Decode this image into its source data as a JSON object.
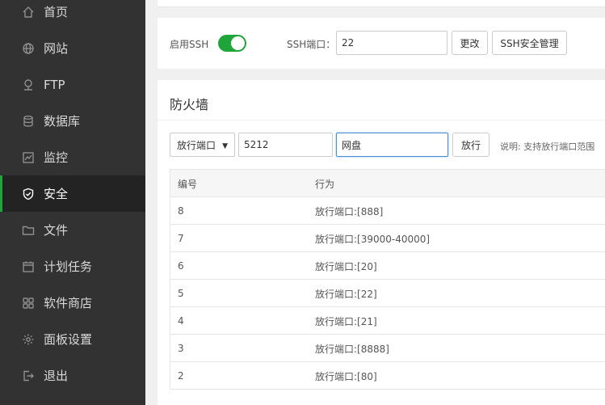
{
  "sidebar": {
    "items": [
      {
        "label": "首页",
        "icon": "home-icon"
      },
      {
        "label": "网站",
        "icon": "globe-icon"
      },
      {
        "label": "FTP",
        "icon": "ftp-icon"
      },
      {
        "label": "数据库",
        "icon": "database-icon"
      },
      {
        "label": "监控",
        "icon": "monitor-icon"
      },
      {
        "label": "安全",
        "icon": "shield-icon",
        "active": true
      },
      {
        "label": "文件",
        "icon": "folder-icon"
      },
      {
        "label": "计划任务",
        "icon": "calendar-icon"
      },
      {
        "label": "软件商店",
        "icon": "grid-icon"
      },
      {
        "label": "面板设置",
        "icon": "gear-icon"
      },
      {
        "label": "退出",
        "icon": "logout-icon"
      }
    ]
  },
  "ssh": {
    "enable_label": "启用SSH",
    "enabled": true,
    "port_label": "SSH端口：",
    "port_value": "22",
    "change_button": "更改",
    "manage_button": "SSH安全管理"
  },
  "firewall": {
    "title": "防火墙",
    "mode_select": "放行端口",
    "port_value": "5212",
    "remark_value": "网盘",
    "release_button": "放行",
    "note": "说明: 支持放行端口范围",
    "columns": [
      "编号",
      "行为"
    ],
    "rows": [
      {
        "id": "8",
        "action": "放行端口:[888]"
      },
      {
        "id": "7",
        "action": "放行端口:[39000-40000]"
      },
      {
        "id": "6",
        "action": "放行端口:[20]"
      },
      {
        "id": "5",
        "action": "放行端口:[22]"
      },
      {
        "id": "4",
        "action": "放行端口:[21]"
      },
      {
        "id": "3",
        "action": "放行端口:[8888]"
      },
      {
        "id": "2",
        "action": "放行端口:[80]"
      }
    ]
  },
  "colors": {
    "sidebar_bg": "#323232",
    "sidebar_active_bg": "#232323",
    "accent_green": "#20a53a",
    "focus_blue": "#4a90d9"
  }
}
